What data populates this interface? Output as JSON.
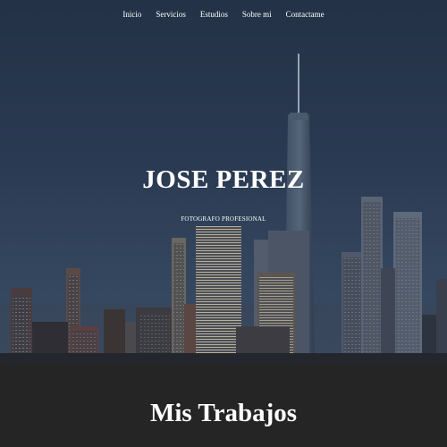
{
  "nav": {
    "items": [
      {
        "label": "Inicio"
      },
      {
        "label": "Servicios"
      },
      {
        "label": "Estudios"
      },
      {
        "label": "Sobre mi"
      },
      {
        "label": "Contactame"
      }
    ]
  },
  "hero": {
    "title": "JOSE PEREZ",
    "subtitle": "FOTOGRAFO PROFESIONAL"
  },
  "works": {
    "title": "Mis Trabajos"
  },
  "colors": {
    "sky": "#2a3a52",
    "section_bg": "#262525",
    "text": "#ffffff"
  }
}
